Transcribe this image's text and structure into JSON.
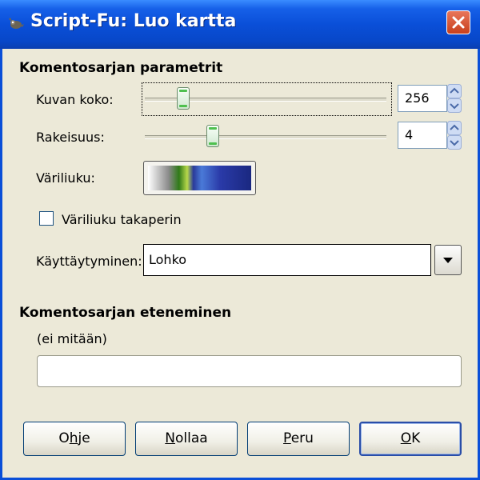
{
  "window": {
    "title": "Script-Fu: Luo kartta"
  },
  "params": {
    "section_title": "Komentosarjan parametrit",
    "size": {
      "label": "Kuvan koko:",
      "value": "256",
      "slider_fraction": 0.14
    },
    "granularity": {
      "label": "Rakeisuus:",
      "value": "4",
      "slider_fraction": 0.27
    },
    "gradient": {
      "label": "Väriliuku:"
    },
    "reverse": {
      "label": "Väriliuku takaperin",
      "checked": false
    },
    "behavior": {
      "label": "Käyttäytyminen:",
      "value": "Lohko"
    }
  },
  "progress": {
    "section_title": "Komentosarjan eteneminen",
    "status": "(ei mitään)",
    "fraction": 0
  },
  "buttons": {
    "help": {
      "pre": "O",
      "mn": "h",
      "post": "je"
    },
    "reset": {
      "pre": "",
      "mn": "N",
      "post": "ollaa"
    },
    "cancel": {
      "pre": "",
      "mn": "P",
      "post": "eru"
    },
    "ok": {
      "pre": "",
      "mn": "O",
      "post": "K"
    }
  },
  "colors": {
    "titlebar": "#0a4fd8",
    "face": "#ece9d8",
    "close": "#d4512a"
  },
  "icons": {
    "app": "gimp-wilber-icon",
    "close": "close-icon",
    "spin_up": "arrow-up-icon",
    "spin_down": "arrow-down-icon",
    "combo": "chevron-down-icon"
  }
}
